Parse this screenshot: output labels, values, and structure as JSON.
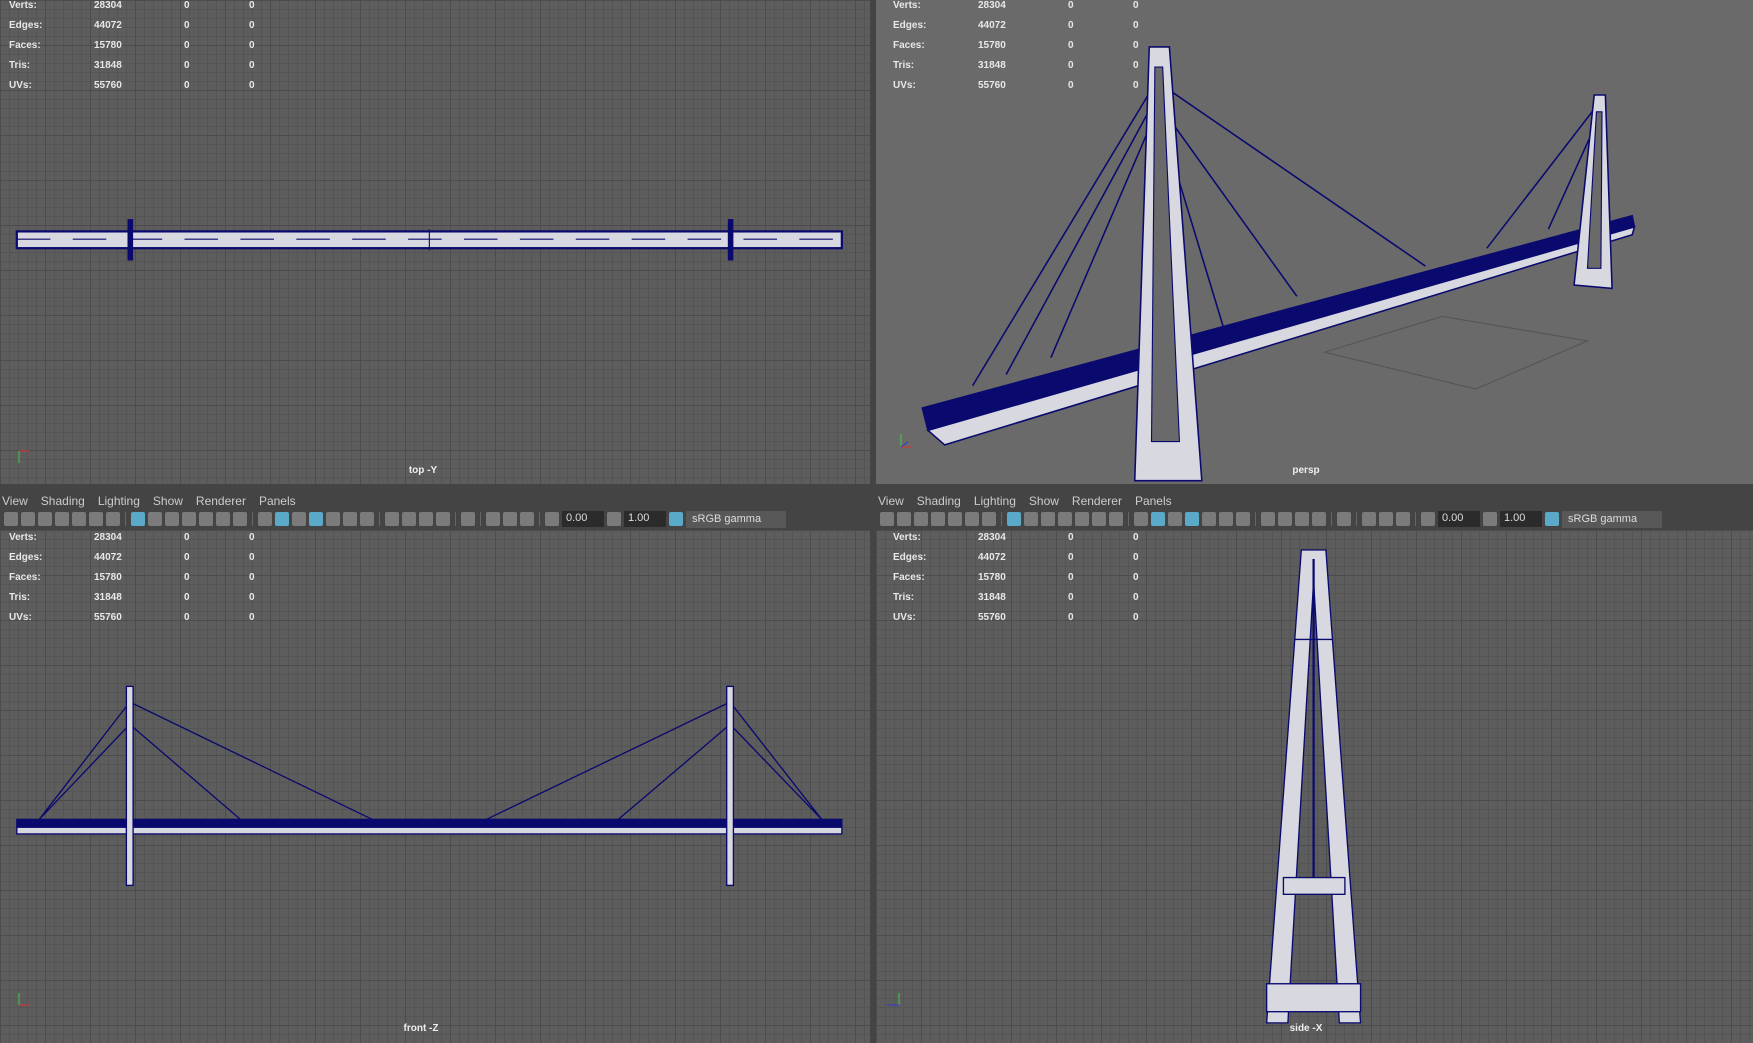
{
  "stats": [
    {
      "label": "Verts:",
      "value": "28304",
      "a": "0",
      "b": "0"
    },
    {
      "label": "Edges:",
      "value": "44072",
      "a": "0",
      "b": "0"
    },
    {
      "label": "Faces:",
      "value": "15780",
      "a": "0",
      "b": "0"
    },
    {
      "label": "Tris:",
      "value": "31848",
      "a": "0",
      "b": "0"
    },
    {
      "label": "UVs:",
      "value": "55760",
      "a": "0",
      "b": "0"
    }
  ],
  "viewports": {
    "top": "top -Y",
    "persp": "persp",
    "front": "front -Z",
    "side": "side -X"
  },
  "menu": [
    "View",
    "Shading",
    "Lighting",
    "Show",
    "Renderer",
    "Panels"
  ],
  "toolbar": {
    "exposure": "0.00",
    "gamma": "1.00",
    "color_space": "sRGB gamma"
  },
  "colors": {
    "wire": "#0a0a6e",
    "model": "#d8d8e0",
    "accent": "#5aa9c8"
  }
}
